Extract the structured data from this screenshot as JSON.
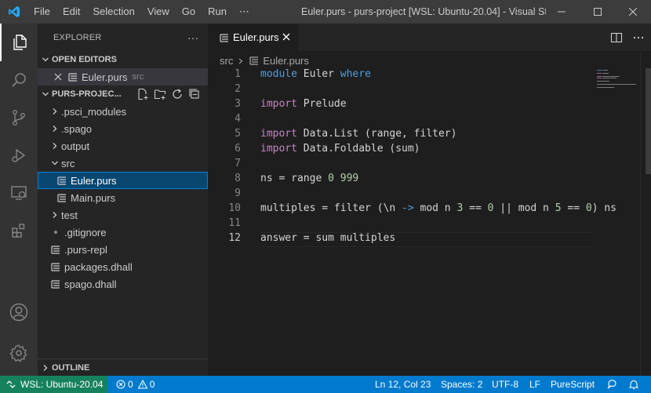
{
  "titlebar": {
    "menu": [
      "File",
      "Edit",
      "Selection",
      "View",
      "Go",
      "Run",
      "⋯"
    ],
    "title": "Euler.purs - purs-project [WSL: Ubuntu-20.04] - Visual St..."
  },
  "activitybar": {
    "items": [
      "explorer",
      "search",
      "source-control",
      "run-debug",
      "remote-explorer",
      "extensions",
      "accounts",
      "manage"
    ]
  },
  "sidebar": {
    "header": "EXPLORER",
    "more": "···",
    "open_editors_label": "OPEN EDITORS",
    "open_editor": {
      "name": "Euler.purs",
      "folder": "src"
    },
    "project_label": "PURS-PROJEC...",
    "tree": [
      {
        "name": ".psci_modules",
        "type": "folder"
      },
      {
        "name": ".spago",
        "type": "folder"
      },
      {
        "name": "output",
        "type": "folder"
      },
      {
        "name": "src",
        "type": "folder-open"
      },
      {
        "name": "Euler.purs",
        "type": "file"
      },
      {
        "name": "Main.purs",
        "type": "file"
      },
      {
        "name": "test",
        "type": "folder"
      },
      {
        "name": ".gitignore",
        "type": "file"
      },
      {
        "name": ".purs-repl",
        "type": "file"
      },
      {
        "name": "packages.dhall",
        "type": "file"
      },
      {
        "name": "spago.dhall",
        "type": "file"
      }
    ],
    "outline_label": "OUTLINE"
  },
  "editor": {
    "tab_label": "Euler.purs",
    "breadcrumb": [
      "src",
      "Euler.purs"
    ],
    "current_line": 12,
    "lines": [
      "module Euler where",
      "",
      "import Prelude",
      "",
      "import Data.List (range, filter)",
      "import Data.Foldable (sum)",
      "",
      "ns = range 0 999",
      "",
      "multiples = filter (\\n -> mod n 3 == 0 || mod n 5 == 0) ns",
      "",
      "answer = sum multiples"
    ]
  },
  "statusbar": {
    "remote": "WSL: Ubuntu-20.04",
    "errors": "0",
    "warnings": "0",
    "position": "Ln 12, Col 23",
    "spaces": "Spaces: 2",
    "encoding": "UTF-8",
    "eol": "LF",
    "language": "PureScript"
  },
  "colors": {
    "accent": "#007acc",
    "remote": "#16825d",
    "keyword": "#569cd6",
    "import_keyword": "#c586c0",
    "number": "#b5cea8",
    "selection": "#094771"
  }
}
